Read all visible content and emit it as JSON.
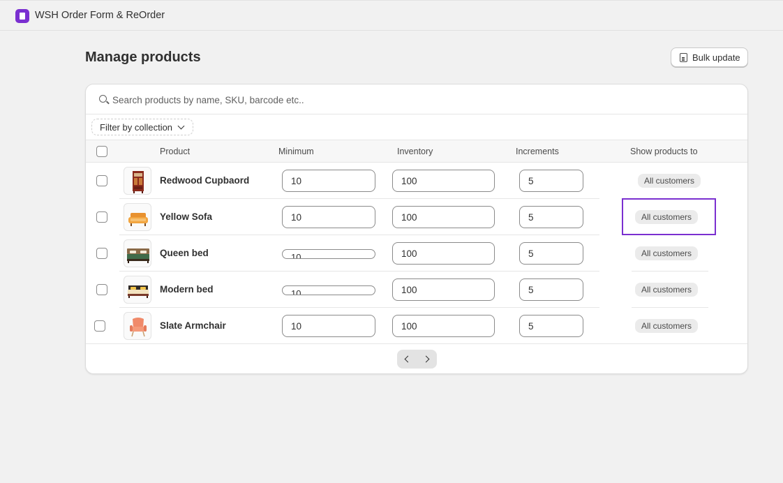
{
  "app": {
    "title": "WSH Order Form & ReOrder",
    "accent_color": "#7a2fd0"
  },
  "page": {
    "title": "Manage products",
    "bulk_update_label": "Bulk update"
  },
  "search": {
    "placeholder": "Search products by name, SKU, barcode etc..",
    "value": ""
  },
  "filter": {
    "label": "Filter by collection"
  },
  "table": {
    "headers": {
      "product": "Product",
      "minimum": "Minimum",
      "inventory": "Inventory",
      "increments": "Increments",
      "show_to": "Show products to"
    },
    "rows": [
      {
        "name": "Redwood Cupbaord",
        "minimum": "10",
        "inventory": "100",
        "increments": "5",
        "show_to": "All customers",
        "thumb_icon": "cupboard-icon"
      },
      {
        "name": "Yellow Sofa",
        "minimum": "10",
        "inventory": "100",
        "increments": "5",
        "show_to": "All customers",
        "thumb_icon": "sofa-icon"
      },
      {
        "name": "Queen bed",
        "minimum": "10",
        "inventory": "100",
        "increments": "5",
        "show_to": "All customers",
        "thumb_icon": "bed-icon"
      },
      {
        "name": "Modern bed",
        "minimum": "10",
        "inventory": "100",
        "increments": "5",
        "show_to": "All customers",
        "thumb_icon": "bed-icon"
      },
      {
        "name": "Slate Armchair",
        "minimum": "10",
        "inventory": "100",
        "increments": "5",
        "show_to": "All customers",
        "thumb_icon": "armchair-icon"
      }
    ]
  },
  "pagination": {
    "prev_icon": "chevron-left-icon",
    "next_icon": "chevron-right-icon"
  }
}
